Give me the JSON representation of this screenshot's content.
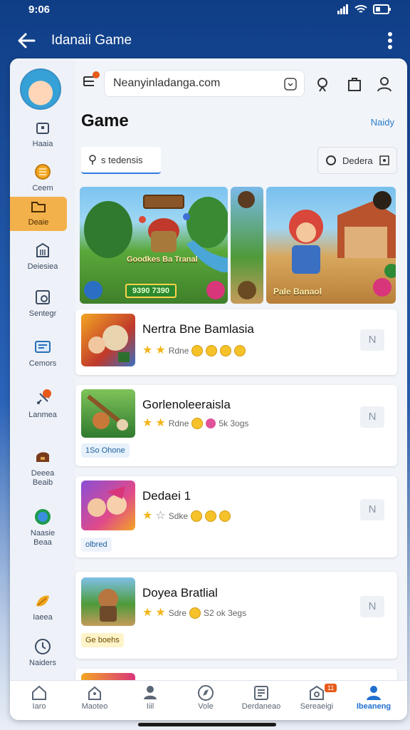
{
  "status": {
    "time": "9:06"
  },
  "appbar": {
    "title": "Idanaii Game"
  },
  "search": {
    "value": "Neanyinladanga.com"
  },
  "page": {
    "title": "Game",
    "see_all": "Naidy"
  },
  "filters": {
    "tab": "s tedensis",
    "sort": "Dedera"
  },
  "sidebar": {
    "items": [
      {
        "label": "Haaia",
        "icon": "house-icon"
      },
      {
        "label": "Ceem",
        "icon": "coin-icon"
      },
      {
        "label": "Deaie",
        "icon": "folder-icon",
        "active": true
      },
      {
        "label": "Deiesiea",
        "icon": "building-icon"
      },
      {
        "label": "Sentegr",
        "icon": "settings-card-icon"
      },
      {
        "label": "Cemors",
        "icon": "monitor-icon"
      },
      {
        "label": "Lanmea",
        "icon": "satellite-icon"
      },
      {
        "label": "Deeea\nBeaib",
        "icon": "treasure-icon"
      },
      {
        "label": "Naasie\nBeaa",
        "icon": "globe-icon"
      },
      {
        "label": "Iaeea",
        "icon": "leaf-icon"
      },
      {
        "label": "Naiders",
        "icon": "clock-icon"
      }
    ]
  },
  "banner": [
    {
      "label": "Goodkes Ba Tranal",
      "price": "9390 7390"
    },
    {
      "label": ""
    },
    {
      "label": "Pale Banaol"
    }
  ],
  "games": [
    {
      "name": "Nertra Bne Bamlasia",
      "rating_text": "Rdne",
      "tag": "",
      "action": "N"
    },
    {
      "name": "Gorlenoleeraisla",
      "rating_text": "Rdne",
      "extra": "5k 3ogs",
      "tag": "1So Ohone",
      "action": "N"
    },
    {
      "name": "Dedaei 1",
      "rating_text": "Sdke",
      "tag": "olbred",
      "action": "N"
    },
    {
      "name": "Doyea Bratlial",
      "rating_text": "Sdre",
      "extra": "S2 ok 3egs",
      "tag": "Ge boehs",
      "action": "N"
    }
  ],
  "bottomnav": [
    {
      "label": "Iaro",
      "icon": "home-icon"
    },
    {
      "label": "Maoteo",
      "icon": "house-outline-icon"
    },
    {
      "label": "Iiil",
      "icon": "person-icon"
    },
    {
      "label": "Vole",
      "icon": "compass-icon"
    },
    {
      "label": "Derdaneao",
      "icon": "news-icon"
    },
    {
      "label": "Sereaeigi",
      "icon": "gift-icon",
      "badge": "11"
    },
    {
      "label": "Ibeaneng",
      "icon": "profile-icon",
      "active": true
    }
  ],
  "colors": {
    "accent": "#1f6fd0",
    "active_side": "#f3b14b",
    "header": "#0f3e86"
  }
}
